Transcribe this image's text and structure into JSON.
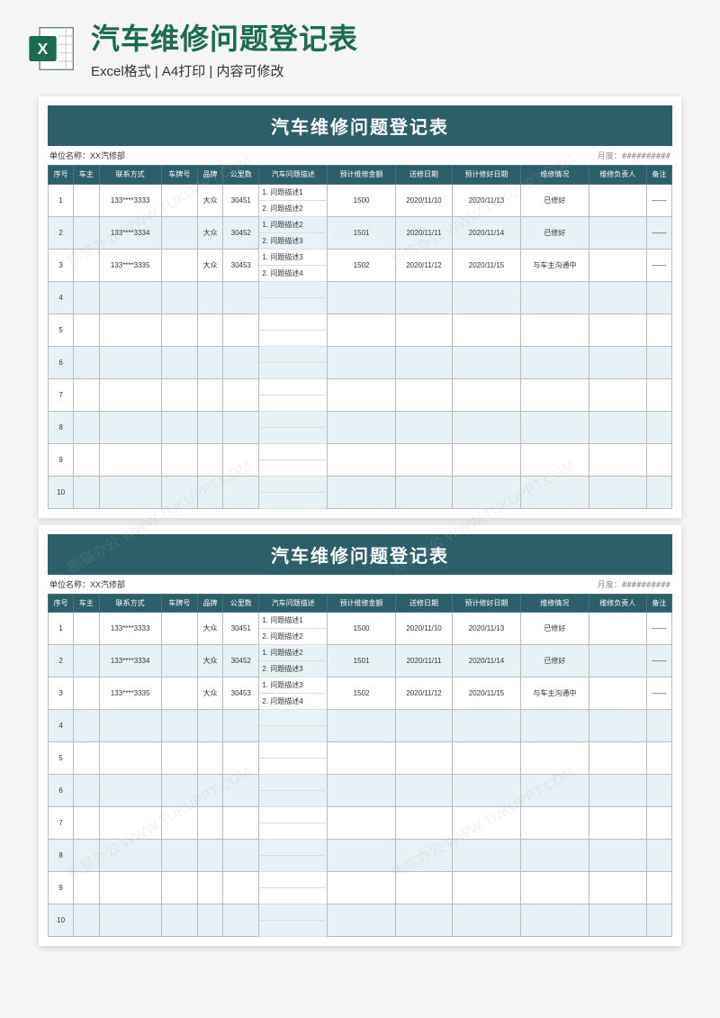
{
  "header": {
    "main_title": "汽车维修问题登记表",
    "sub_title": "Excel格式 | A4打印 | 内容可修改"
  },
  "form": {
    "banner_title": "汽车维修问题登记表",
    "meta_label_left": "单位名称：",
    "meta_value_left": "XX汽修部",
    "meta_label_right": "月度：",
    "meta_value_right": "##########",
    "columns": [
      "序号",
      "车主",
      "联系方式",
      "车牌号",
      "品牌",
      "公里数",
      "汽车问题描述",
      "预计维修金额",
      "送修日期",
      "预计修好日期",
      "维修情况",
      "维修负责人",
      "备注"
    ],
    "rows": [
      {
        "seq": "1",
        "owner": "",
        "phone": "133****3333",
        "plate": "",
        "brand": "大众",
        "km": "30451",
        "desc1": "1. 问题描述1",
        "desc2": "2. 问题描述2",
        "amount": "1500",
        "send": "2020/11/10",
        "done": "2020/11/13",
        "status": "已修好",
        "person": "",
        "note": "——"
      },
      {
        "seq": "2",
        "owner": "",
        "phone": "133****3334",
        "plate": "",
        "brand": "大众",
        "km": "30452",
        "desc1": "1. 问题描述2",
        "desc2": "2. 问题描述3",
        "amount": "1501",
        "send": "2020/11/11",
        "done": "2020/11/14",
        "status": "已修好",
        "person": "",
        "note": "——"
      },
      {
        "seq": "3",
        "owner": "",
        "phone": "133****3335",
        "plate": "",
        "brand": "大众",
        "km": "30453",
        "desc1": "1. 问题描述3",
        "desc2": "2. 问题描述4",
        "amount": "1502",
        "send": "2020/11/12",
        "done": "2020/11/15",
        "status": "与车主沟通中",
        "person": "",
        "note": "——"
      },
      {
        "seq": "4"
      },
      {
        "seq": "5"
      },
      {
        "seq": "6"
      },
      {
        "seq": "7"
      },
      {
        "seq": "8"
      },
      {
        "seq": "9"
      },
      {
        "seq": "10"
      }
    ]
  },
  "watermark": "熊猫办公 WWW.TUKUPPT.COM"
}
